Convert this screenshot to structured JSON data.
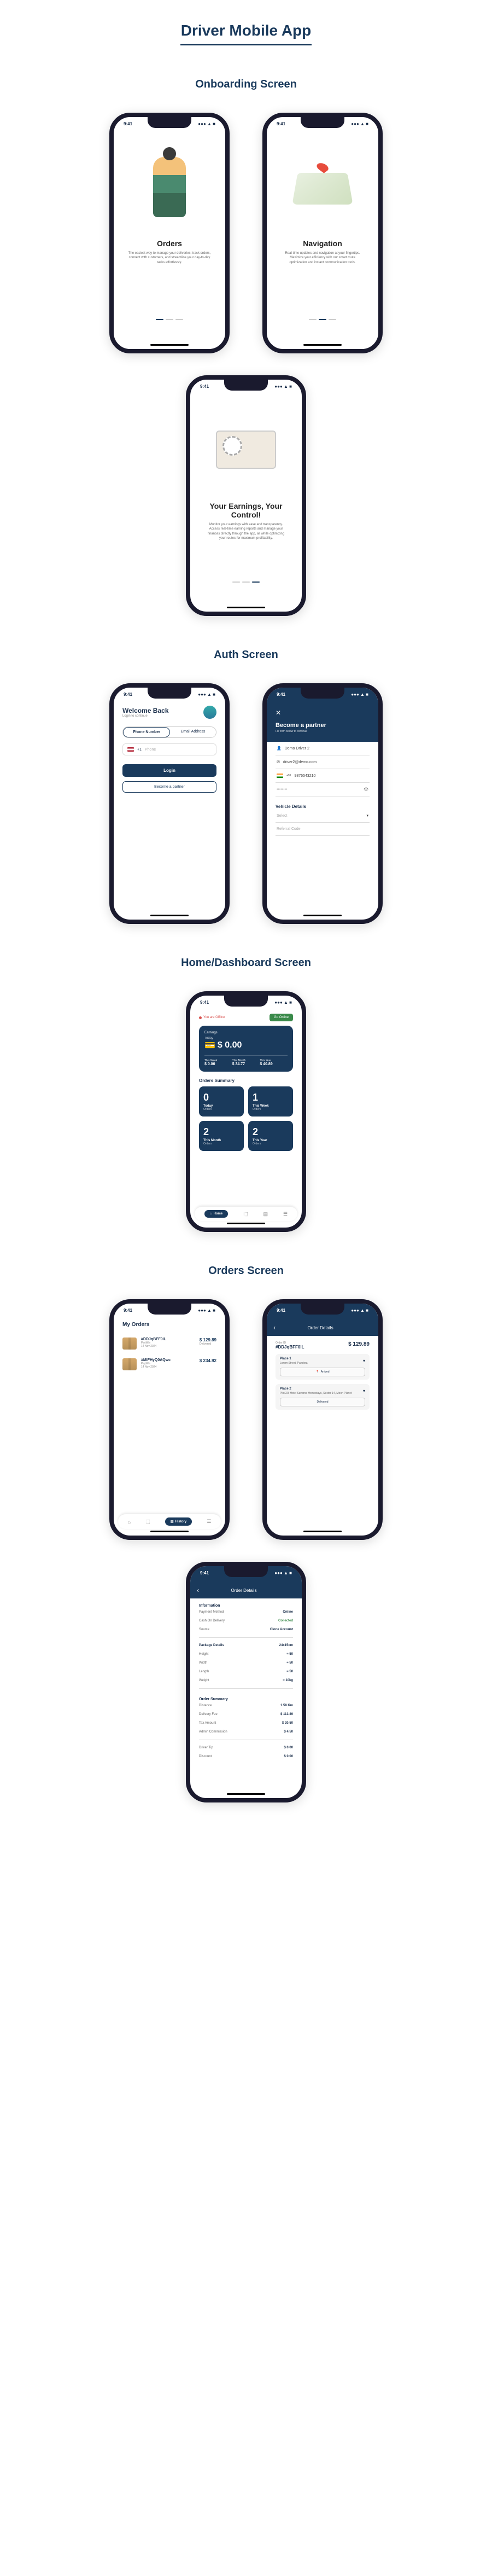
{
  "page_title": "Driver Mobile App",
  "sections": {
    "onboarding": "Onboarding Screen",
    "auth": "Auth Screen",
    "home": "Home/Dashboard Screen",
    "orders": "Orders Screen"
  },
  "status_time": "9:41",
  "onboarding": [
    {
      "title": "Orders",
      "desc": "The easiest way to manage your deliveries: track orders, connect with customers, and streamline your day-to-day tasks effortlessly."
    },
    {
      "title": "Navigation",
      "desc": "Real-time updates and navigation at your fingertips. Maximize your efficiency with our smart route optimization and instant communication tools."
    },
    {
      "title": "Your Earnings, Your Control!",
      "desc": "Monitor your earnings with ease and transparency. Access real-time earning reports and manage your finances directly through the app, all while optimizing your routes for maximum profitability."
    }
  ],
  "login": {
    "welcome": "Welcome Back",
    "sub": "Login to continue",
    "tab1": "Phone Number",
    "tab2": "Email Address",
    "phone_placeholder": "Phone",
    "flag_code": "+1",
    "login_btn": "Login",
    "partner_btn": "Become a partner"
  },
  "partner": {
    "title": "Become a partner",
    "sub": "Fill form below to continue",
    "name": "Demo Driver 2",
    "email": "driver2@demo.com",
    "phone": "9876543210",
    "vehicle_label": "Vehicle Details",
    "referral_placeholder": "Referral Code"
  },
  "dashboard": {
    "offline": "You are Offline",
    "go_online": "Go Online",
    "earnings_lbl": "Earnings",
    "today_lbl": "Today",
    "amount": "$ 0.00",
    "stats": [
      {
        "l": "This Week",
        "v": "$ 0.00"
      },
      {
        "l": "This Month",
        "v": "$ 34.77"
      },
      {
        "l": "This Year",
        "v": "$ 40.89"
      }
    ],
    "summary_lbl": "Orders Summary",
    "tiles": [
      {
        "n": "0",
        "t": "Today",
        "s": "Orders"
      },
      {
        "n": "1",
        "t": "This Week",
        "s": "Orders"
      },
      {
        "n": "2",
        "t": "This Month",
        "s": "Orders"
      },
      {
        "n": "2",
        "t": "This Year",
        "s": "Orders"
      }
    ],
    "nav_home": "Home",
    "nav_history": "History"
  },
  "orders_list": {
    "title": "My Orders",
    "orders": [
      {
        "id": "#DDJqBFF0IL",
        "meta": "PayWin",
        "date": "14 Nov 2024",
        "price": "$ 129.89",
        "status": "Delivered"
      },
      {
        "id": "#MIFHyQ0AQwc",
        "meta": "PayWin",
        "date": "14 Nov 2024",
        "price": "$ 234.92",
        "status": ""
      }
    ]
  },
  "order_details": {
    "header": "Order Details",
    "id_lbl": "Order ID",
    "id": "#DDJqBFF0IL",
    "price": "$ 129.89",
    "places": [
      {
        "pl": "Place 1",
        "ad": "Lorem Street,\nPandora",
        "more": "▾"
      },
      {
        "pl": "Place 2",
        "ad": "Plot 2/3 Hotel Savarna Homestays, Sector 14,\nMoon Planet",
        "btn": "Delivered"
      }
    ],
    "info_header": "Information",
    "info": [
      {
        "k": "Payment Method",
        "v": "Online"
      },
      {
        "k": "Cash On Delivery",
        "v": "Collected",
        "green": true
      },
      {
        "k": "Source",
        "v": "Clone Account"
      }
    ],
    "pkg_lbl": "Package Details",
    "pkg": [
      {
        "k": "Dimension",
        "v": "24x15cm"
      },
      {
        "k": "Height",
        "v": "≈ 50"
      },
      {
        "k": "Width",
        "v": "≈ 50"
      },
      {
        "k": "Length",
        "v": "≈ 50"
      },
      {
        "k": "Weight",
        "v": "≈ 10kg"
      }
    ],
    "ord_sum_lbl": "Order Summary",
    "sum": [
      {
        "k": "Distance",
        "v": "1.58 Km"
      },
      {
        "k": "Delivery Fee",
        "v": "$ 113.89"
      },
      {
        "k": "Tax Amount",
        "v": "$ 20.50"
      },
      {
        "k": "Admin Commission",
        "v": "$ 4.50"
      }
    ],
    "tip_lbl": "Driver Tip",
    "tip_val": "$ 0.00",
    "disc_lbl": "Discount",
    "disc_val": "$ 0.00"
  }
}
